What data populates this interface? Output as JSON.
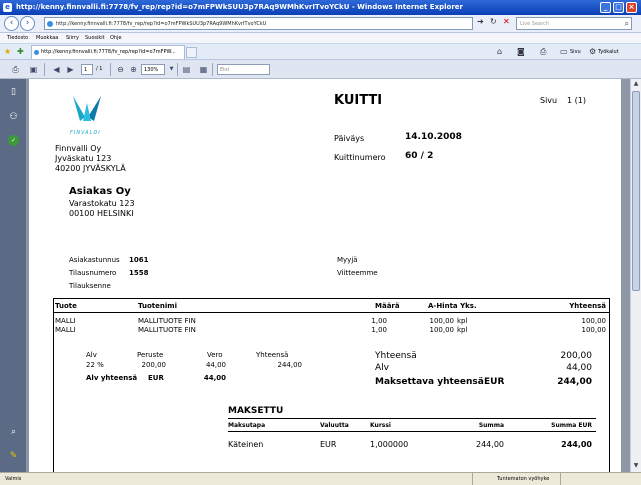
{
  "window": {
    "title": "http://kenny.finnvalli.fi:7778/fv_rep/rep?id=o7mFPWkSUU3p7RAq9WMhKvrITvoYCkU - Windows Internet Explorer"
  },
  "browser": {
    "address": "http://kenny.finnvalli.fi:7778/fv_rep/rep?id=o7mFPWkSUU3p7RAq9WMhKvrITvoYCkU",
    "search_placeholder": "Live Search",
    "tab_title": "http://kenny.finnvalli.fi:7778/fv_rep/rep?id=o7mFPW...",
    "menu": [
      "Tiedosto",
      "Muokkaa",
      "Siirry",
      "Suosikit",
      "Ohje"
    ],
    "toolbar": {
      "page": "Sivu",
      "tools": "Työkalut"
    }
  },
  "pdf_toolbar": {
    "page_input": "1",
    "page_total": "/ 1",
    "zoom": "130%",
    "find_placeholder": "Etsi"
  },
  "receipt": {
    "title": "KUITTI",
    "page_label": "Sivu",
    "page_value": "1 (1)",
    "logo_text": "FINVALDI",
    "sender": {
      "name": "Finnvalli Oy",
      "street": "Jyväskatu 123",
      "city": "40200 JYVÄSKYLÄ"
    },
    "date_label": "Päiväys",
    "date_value": "14.10.2008",
    "number_label": "Kuittinumero",
    "number_value": "60 / 2",
    "recipient": {
      "name": "Asiakas Oy",
      "street": "Varastokatu 123",
      "city": "00100 HELSINKI"
    },
    "customer_no_label": "Asiakastunnus",
    "customer_no_value": "1061",
    "order_no_label": "Tilausnumero",
    "order_no_value": "1558",
    "order_maker_label": "Tilauksenne",
    "seller_label": "Myyjä",
    "our_ref_label": "Viitteemme",
    "items_header": {
      "product": "Tuote",
      "name": "Tuotenimi",
      "qty": "Määrä",
      "unit_price": "A-Hinta Yks.",
      "total": "Yhteensä"
    },
    "items": [
      {
        "product": "MALLI",
        "name": "MALLITUOTE FIN",
        "qty": "1,00",
        "unit_price": "100,00",
        "unit": "kpl",
        "total": "100,00"
      },
      {
        "product": "MALLI",
        "name": "MALLITUOTE FIN",
        "qty": "1,00",
        "unit_price": "100,00",
        "unit": "kpl",
        "total": "100,00"
      }
    ],
    "vat": {
      "h_alv": "Alv",
      "h_base": "Peruste",
      "h_tax": "Vero",
      "h_total": "Yhteensä",
      "rate": "22 %",
      "base": "200,00",
      "tax": "44,00",
      "total": "244,00",
      "sum_label": "Alv yhteensä",
      "sum_currency": "EUR",
      "sum_value": "44,00"
    },
    "totals": {
      "sum_label": "Yhteensä",
      "sum_value": "200,00",
      "vat_label": "Alv",
      "vat_value": "44,00",
      "payable_label": "Maksettava yhteensä",
      "payable_currency": "EUR",
      "payable_value": "244,00"
    },
    "paid": {
      "title": "MAKSETTU",
      "header": {
        "method": "Maksutapa",
        "currency": "Valuutta",
        "rate": "Kurssi",
        "amount": "Summa",
        "amount_eur": "Summa EUR"
      },
      "row": {
        "method": "Käteinen",
        "currency": "EUR",
        "rate": "1,000000",
        "amount": "244,00",
        "amount_eur": "244,00"
      }
    }
  },
  "statusbar": {
    "left": "Valmis",
    "zone": "Tuntematon vyöhyke"
  }
}
